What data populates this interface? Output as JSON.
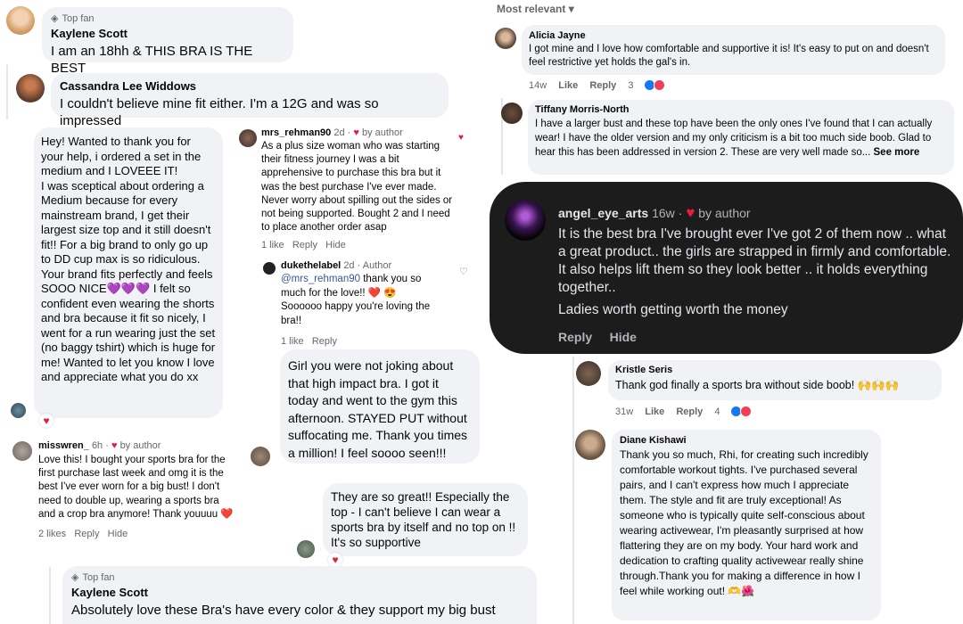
{
  "c1": {
    "badge": "Top fan",
    "name": "Kaylene Scott",
    "text": "I am an 18hh & THIS BRA IS THE BEST"
  },
  "c2": {
    "name": "Cassandra Lee Widdows",
    "text": "I couldn't believe mine fit either. I'm a 12G and was so impressed"
  },
  "c3": {
    "text": "Hey! Wanted to thank you for your help, i ordered a set in the medium and I LOVEEE IT!\nI was sceptical about ordering a Medium because for every mainstream brand, I get their largest size top and it still doesn't fit!! For a big brand to only go up to DD cup max is so ridiculous.\nYour brand fits perfectly and feels SOOO NICE💜💜💜 I felt so confident even wearing the shorts and bra because it fit so nicely, I went for a run wearing just the set (no baggy tshirt) which is huge for me! Wanted to let you know I love and appreciate what you do xx",
    "reaction": "♥"
  },
  "c4": {
    "name": "mrs_rehman90",
    "time": "2d ·",
    "heart": "♥",
    "by": "by author",
    "text": "As a plus size woman who was starting their fitness journey I was a bit apprehensive to purchase this bra but it was the best purchase I've ever made. Never worry about spilling out the sides or not being supported. Bought 2 and I need to place another order asap",
    "likes": "1 like",
    "reply": "Reply",
    "hide": "Hide",
    "icon": "♥"
  },
  "c5": {
    "name": "dukethelabel",
    "time": "2d ·",
    "role": "Author",
    "mention": "@mrs_rehman90",
    "text": " thank you so much for the love!! ❤️ 😍\nSoooooo happy you're loving the bra!!",
    "likes": "1 like",
    "reply": "Reply",
    "icon": "♡"
  },
  "c6": {
    "text": "Girl you were not joking about that high impact bra. I got it today and went to the gym this afternoon. STAYED PUT without suffocating me. Thank you times a million! I feel soooo seen!!!"
  },
  "c7": {
    "name": "misswren_",
    "time": "6h ·",
    "heart": "♥",
    "by": "by author",
    "text": "Love this! I bought your sports bra for the first purchase last week and omg it is the best I've ever worn for a big bust! I don't need to double up, wearing a sports bra and a crop bra anymore! Thank youuuu ❤️",
    "likes": "2 likes",
    "reply": "Reply",
    "hide": "Hide"
  },
  "c8": {
    "text": "They are so great!! Especially the top - I can't believe I can wear a sports bra by itself and no top on !! It's so supportive",
    "reaction": "♥"
  },
  "c9": {
    "badge": "Top fan",
    "name": "Kaylene Scott",
    "text": "Absolutely love these Bra's have every color & they support my big bust"
  },
  "r0": {
    "label": "Most relevant",
    "chevron": "▾"
  },
  "r1": {
    "name": "Alicia Jayne",
    "text": "I got mine and I love how comfortable and supportive it is! It's easy to put on and doesn't feel restrictive yet holds the gal's in.",
    "time": "14w",
    "like": "Like",
    "reply": "Reply",
    "count": "3"
  },
  "r2": {
    "name": "Tiffany Morris-North",
    "text": "I have a larger bust and these top have been the only ones I've found that I can actually wear! I have the older version and my only criticism is a bit too much side boob. Glad to hear this has been addressed in version 2. These are very well made so...",
    "more": "See more"
  },
  "r3": {
    "name": "angel_eye_arts",
    "time": "16w ·",
    "heart": "♥",
    "by": "by author",
    "text": "It is the best bra I've brought ever I've got 2 of them now .. what a great product.. the girls are strapped in firmly and comfortable. It also helps lift them so they look better .. it holds everything together..",
    "text2": "Ladies worth getting worth the money",
    "reply": "Reply",
    "hide": "Hide"
  },
  "r4": {
    "name": "Kristle Seris",
    "text": "Thank god finally a sports bra without side boob! 🙌🙌🙌",
    "time": "31w",
    "like": "Like",
    "reply": "Reply",
    "count": "4"
  },
  "r5": {
    "name": "Diane Kishawi",
    "text": "Thank you so much, Rhi, for creating such incredibly comfortable workout tights. I've purchased several pairs, and I can't express how much I appreciate them. The style and fit are truly exceptional! As someone who is typically quite self-conscious about wearing activewear, I'm pleasantly surprised at how flattering they are on my body. Your hard work and dedication to crafting quality activewear really shine through.Thank you for making a difference in how I feel while working out! 🫶🌺"
  },
  "colors": {
    "bubble": "#f0f2f5",
    "like": "#1877f2",
    "love": "#f33e58",
    "dark": "#1c1c1d",
    "muted": "#65676b"
  }
}
